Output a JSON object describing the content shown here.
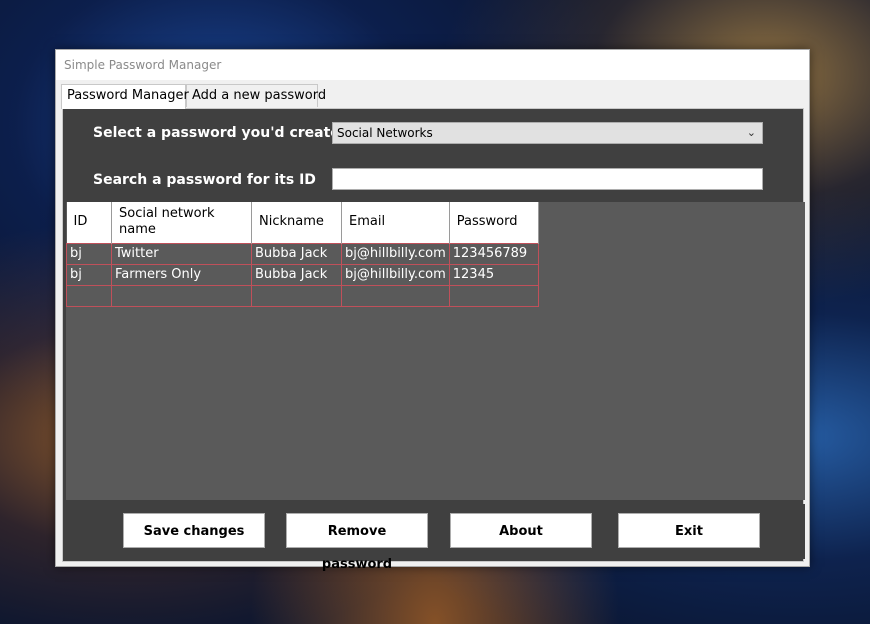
{
  "window": {
    "title": "Simple Password Manager"
  },
  "tabs": [
    {
      "label": "Password Manager",
      "active": true
    },
    {
      "label": "Add a new password",
      "active": false
    }
  ],
  "form": {
    "select_label": "Select a password you'd created",
    "select_value": "Social Networks",
    "search_label": "Search a password for its ID",
    "search_value": ""
  },
  "table": {
    "headers": [
      "ID",
      "Social network name",
      "Nickname",
      "Email",
      "Password"
    ],
    "rows": [
      [
        "bj",
        "Twitter",
        "Bubba Jack",
        "bj@hillbilly.com",
        "123456789"
      ],
      [
        "bj",
        "Farmers Only",
        "Bubba Jack",
        "bj@hillbilly.com",
        "12345"
      ],
      [
        "",
        "",
        "",
        "",
        ""
      ]
    ]
  },
  "buttons": {
    "save": "Save changes",
    "remove": "Remove password",
    "about": "About",
    "exit": "Exit"
  },
  "colors": {
    "panel_bg": "#404040",
    "grid_bg": "#5a5a5a",
    "grid_line": "#c0505a"
  }
}
